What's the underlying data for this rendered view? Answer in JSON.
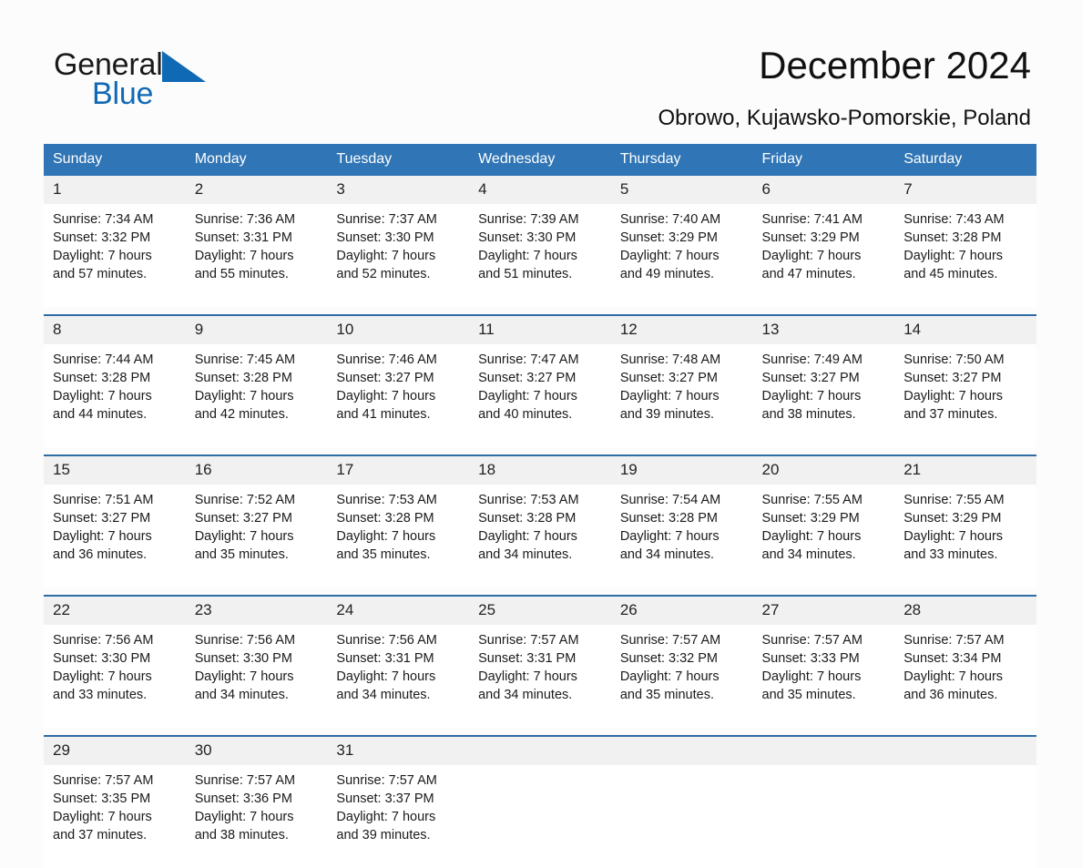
{
  "brand": {
    "name_part1": "General",
    "name_part2": "Blue",
    "triangle_icon": "triangle-icon",
    "accent_color": "#1069b4"
  },
  "header": {
    "title": "December 2024",
    "subtitle": "Obrowo, Kujawsko-Pomorskie, Poland"
  },
  "theme": {
    "header_bg": "#3075b5",
    "week_rule": "#2e6da4",
    "date_band_bg": "#f1f1f1",
    "page_bg": "#fcfcfc"
  },
  "calendar": {
    "weekday_headers": [
      "Sunday",
      "Monday",
      "Tuesday",
      "Wednesday",
      "Thursday",
      "Friday",
      "Saturday"
    ],
    "labels": {
      "sunrise": "Sunrise:",
      "sunset": "Sunset:",
      "daylight": "Daylight:"
    },
    "weeks": [
      {
        "days": [
          {
            "date": "1",
            "sunrise": "Sunrise: 7:34 AM",
            "sunset": "Sunset: 3:32 PM",
            "daylight_l1": "Daylight: 7 hours",
            "daylight_l2": "and 57 minutes."
          },
          {
            "date": "2",
            "sunrise": "Sunrise: 7:36 AM",
            "sunset": "Sunset: 3:31 PM",
            "daylight_l1": "Daylight: 7 hours",
            "daylight_l2": "and 55 minutes."
          },
          {
            "date": "3",
            "sunrise": "Sunrise: 7:37 AM",
            "sunset": "Sunset: 3:30 PM",
            "daylight_l1": "Daylight: 7 hours",
            "daylight_l2": "and 52 minutes."
          },
          {
            "date": "4",
            "sunrise": "Sunrise: 7:39 AM",
            "sunset": "Sunset: 3:30 PM",
            "daylight_l1": "Daylight: 7 hours",
            "daylight_l2": "and 51 minutes."
          },
          {
            "date": "5",
            "sunrise": "Sunrise: 7:40 AM",
            "sunset": "Sunset: 3:29 PM",
            "daylight_l1": "Daylight: 7 hours",
            "daylight_l2": "and 49 minutes."
          },
          {
            "date": "6",
            "sunrise": "Sunrise: 7:41 AM",
            "sunset": "Sunset: 3:29 PM",
            "daylight_l1": "Daylight: 7 hours",
            "daylight_l2": "and 47 minutes."
          },
          {
            "date": "7",
            "sunrise": "Sunrise: 7:43 AM",
            "sunset": "Sunset: 3:28 PM",
            "daylight_l1": "Daylight: 7 hours",
            "daylight_l2": "and 45 minutes."
          }
        ]
      },
      {
        "days": [
          {
            "date": "8",
            "sunrise": "Sunrise: 7:44 AM",
            "sunset": "Sunset: 3:28 PM",
            "daylight_l1": "Daylight: 7 hours",
            "daylight_l2": "and 44 minutes."
          },
          {
            "date": "9",
            "sunrise": "Sunrise: 7:45 AM",
            "sunset": "Sunset: 3:28 PM",
            "daylight_l1": "Daylight: 7 hours",
            "daylight_l2": "and 42 minutes."
          },
          {
            "date": "10",
            "sunrise": "Sunrise: 7:46 AM",
            "sunset": "Sunset: 3:27 PM",
            "daylight_l1": "Daylight: 7 hours",
            "daylight_l2": "and 41 minutes."
          },
          {
            "date": "11",
            "sunrise": "Sunrise: 7:47 AM",
            "sunset": "Sunset: 3:27 PM",
            "daylight_l1": "Daylight: 7 hours",
            "daylight_l2": "and 40 minutes."
          },
          {
            "date": "12",
            "sunrise": "Sunrise: 7:48 AM",
            "sunset": "Sunset: 3:27 PM",
            "daylight_l1": "Daylight: 7 hours",
            "daylight_l2": "and 39 minutes."
          },
          {
            "date": "13",
            "sunrise": "Sunrise: 7:49 AM",
            "sunset": "Sunset: 3:27 PM",
            "daylight_l1": "Daylight: 7 hours",
            "daylight_l2": "and 38 minutes."
          },
          {
            "date": "14",
            "sunrise": "Sunrise: 7:50 AM",
            "sunset": "Sunset: 3:27 PM",
            "daylight_l1": "Daylight: 7 hours",
            "daylight_l2": "and 37 minutes."
          }
        ]
      },
      {
        "days": [
          {
            "date": "15",
            "sunrise": "Sunrise: 7:51 AM",
            "sunset": "Sunset: 3:27 PM",
            "daylight_l1": "Daylight: 7 hours",
            "daylight_l2": "and 36 minutes."
          },
          {
            "date": "16",
            "sunrise": "Sunrise: 7:52 AM",
            "sunset": "Sunset: 3:27 PM",
            "daylight_l1": "Daylight: 7 hours",
            "daylight_l2": "and 35 minutes."
          },
          {
            "date": "17",
            "sunrise": "Sunrise: 7:53 AM",
            "sunset": "Sunset: 3:28 PM",
            "daylight_l1": "Daylight: 7 hours",
            "daylight_l2": "and 35 minutes."
          },
          {
            "date": "18",
            "sunrise": "Sunrise: 7:53 AM",
            "sunset": "Sunset: 3:28 PM",
            "daylight_l1": "Daylight: 7 hours",
            "daylight_l2": "and 34 minutes."
          },
          {
            "date": "19",
            "sunrise": "Sunrise: 7:54 AM",
            "sunset": "Sunset: 3:28 PM",
            "daylight_l1": "Daylight: 7 hours",
            "daylight_l2": "and 34 minutes."
          },
          {
            "date": "20",
            "sunrise": "Sunrise: 7:55 AM",
            "sunset": "Sunset: 3:29 PM",
            "daylight_l1": "Daylight: 7 hours",
            "daylight_l2": "and 34 minutes."
          },
          {
            "date": "21",
            "sunrise": "Sunrise: 7:55 AM",
            "sunset": "Sunset: 3:29 PM",
            "daylight_l1": "Daylight: 7 hours",
            "daylight_l2": "and 33 minutes."
          }
        ]
      },
      {
        "days": [
          {
            "date": "22",
            "sunrise": "Sunrise: 7:56 AM",
            "sunset": "Sunset: 3:30 PM",
            "daylight_l1": "Daylight: 7 hours",
            "daylight_l2": "and 33 minutes."
          },
          {
            "date": "23",
            "sunrise": "Sunrise: 7:56 AM",
            "sunset": "Sunset: 3:30 PM",
            "daylight_l1": "Daylight: 7 hours",
            "daylight_l2": "and 34 minutes."
          },
          {
            "date": "24",
            "sunrise": "Sunrise: 7:56 AM",
            "sunset": "Sunset: 3:31 PM",
            "daylight_l1": "Daylight: 7 hours",
            "daylight_l2": "and 34 minutes."
          },
          {
            "date": "25",
            "sunrise": "Sunrise: 7:57 AM",
            "sunset": "Sunset: 3:31 PM",
            "daylight_l1": "Daylight: 7 hours",
            "daylight_l2": "and 34 minutes."
          },
          {
            "date": "26",
            "sunrise": "Sunrise: 7:57 AM",
            "sunset": "Sunset: 3:32 PM",
            "daylight_l1": "Daylight: 7 hours",
            "daylight_l2": "and 35 minutes."
          },
          {
            "date": "27",
            "sunrise": "Sunrise: 7:57 AM",
            "sunset": "Sunset: 3:33 PM",
            "daylight_l1": "Daylight: 7 hours",
            "daylight_l2": "and 35 minutes."
          },
          {
            "date": "28",
            "sunrise": "Sunrise: 7:57 AM",
            "sunset": "Sunset: 3:34 PM",
            "daylight_l1": "Daylight: 7 hours",
            "daylight_l2": "and 36 minutes."
          }
        ]
      },
      {
        "days": [
          {
            "date": "29",
            "sunrise": "Sunrise: 7:57 AM",
            "sunset": "Sunset: 3:35 PM",
            "daylight_l1": "Daylight: 7 hours",
            "daylight_l2": "and 37 minutes."
          },
          {
            "date": "30",
            "sunrise": "Sunrise: 7:57 AM",
            "sunset": "Sunset: 3:36 PM",
            "daylight_l1": "Daylight: 7 hours",
            "daylight_l2": "and 38 minutes."
          },
          {
            "date": "31",
            "sunrise": "Sunrise: 7:57 AM",
            "sunset": "Sunset: 3:37 PM",
            "daylight_l1": "Daylight: 7 hours",
            "daylight_l2": "and 39 minutes."
          },
          {
            "date": "",
            "sunrise": "",
            "sunset": "",
            "daylight_l1": "",
            "daylight_l2": ""
          },
          {
            "date": "",
            "sunrise": "",
            "sunset": "",
            "daylight_l1": "",
            "daylight_l2": ""
          },
          {
            "date": "",
            "sunrise": "",
            "sunset": "",
            "daylight_l1": "",
            "daylight_l2": ""
          },
          {
            "date": "",
            "sunrise": "",
            "sunset": "",
            "daylight_l1": "",
            "daylight_l2": ""
          }
        ]
      }
    ]
  }
}
